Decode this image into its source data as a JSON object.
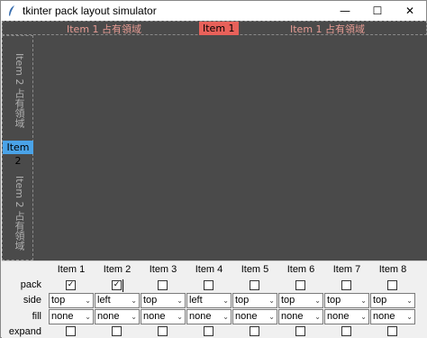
{
  "window": {
    "title": "tkinter pack layout simulator",
    "minimize_glyph": "—",
    "maximize_glyph": "☐",
    "close_glyph": "✕",
    "app_icon": "feather-icon"
  },
  "canvas": {
    "background": "#4a4a4a",
    "top_region_text_left": "Item 1 占有領域",
    "top_region_text_right": "Item 1 占有領域",
    "item1_label": "Item 1",
    "item1_color": "#e8615a",
    "left_region_text_top": "Item 2 占有領域",
    "left_region_text_bottom": "Item 2 占有領域",
    "item2_label": "Item 2",
    "item2_color": "#4aa3e8"
  },
  "panel": {
    "row_labels": {
      "pack": "pack",
      "side": "side",
      "fill": "fill",
      "expand": "expand"
    },
    "items": [
      {
        "name": "Item 1",
        "pack": true,
        "side": "top",
        "fill": "none",
        "expand": false
      },
      {
        "name": "Item 2",
        "pack": true,
        "side": "left",
        "fill": "none",
        "expand": false
      },
      {
        "name": "Item 3",
        "pack": false,
        "side": "top",
        "fill": "none",
        "expand": false
      },
      {
        "name": "Item 4",
        "pack": false,
        "side": "left",
        "fill": "none",
        "expand": false
      },
      {
        "name": "Item 5",
        "pack": false,
        "side": "top",
        "fill": "none",
        "expand": false
      },
      {
        "name": "Item 6",
        "pack": false,
        "side": "top",
        "fill": "none",
        "expand": false
      },
      {
        "name": "Item 7",
        "pack": false,
        "side": "top",
        "fill": "none",
        "expand": false
      },
      {
        "name": "Item 8",
        "pack": false,
        "side": "top",
        "fill": "none",
        "expand": false
      }
    ]
  }
}
